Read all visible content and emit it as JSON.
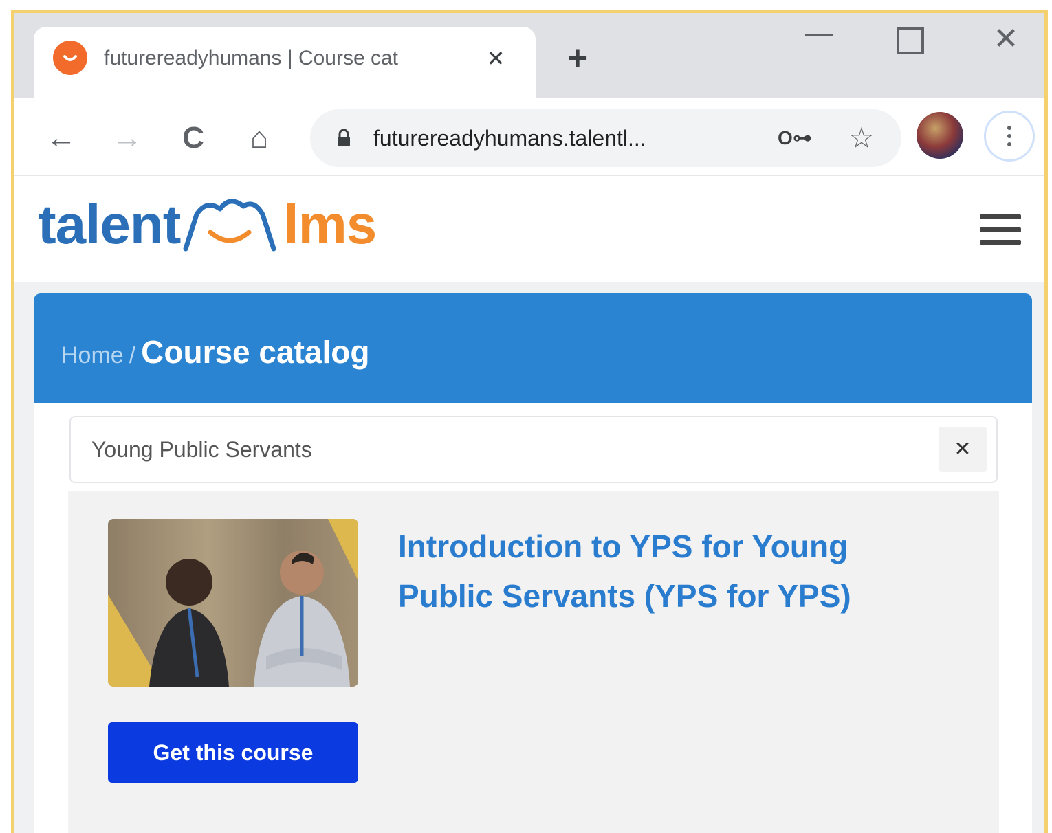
{
  "browser": {
    "tab": {
      "title": "futurereadyhumans | Course cat",
      "close_glyph": "✕"
    },
    "new_tab_glyph": "+",
    "window_controls": {
      "minimize": "",
      "maximize": "",
      "close": "✕"
    },
    "toolbar": {
      "back_glyph": "←",
      "forward_glyph": "→",
      "reload_glyph": "C",
      "home_glyph": "⌂",
      "url": "futurereadyhumans.talentl...",
      "key_glyph": "O⊶",
      "star_glyph": "☆"
    }
  },
  "site": {
    "logo": {
      "part1": "talent",
      "part2": "lms"
    },
    "breadcrumb": {
      "home": "Home",
      "separator": "/",
      "current": "Course catalog"
    },
    "search": {
      "value": "Young Public Servants",
      "clear_glyph": "✕"
    },
    "courses": [
      {
        "title": "Introduction to YPS for Young Public Servants (YPS for YPS)",
        "button": "Get this course"
      }
    ]
  },
  "colors": {
    "accent_blue": "#2a84d2",
    "button_blue": "#0b3be0",
    "logo_orange": "#f28c2c",
    "logo_blue": "#2a6fb7",
    "frame_yellow": "#f4d06f"
  },
  "icons": [
    "favicon-icon",
    "close-icon",
    "plus-icon",
    "back-arrow-icon",
    "forward-arrow-icon",
    "reload-icon",
    "home-icon",
    "lock-icon",
    "key-icon",
    "star-icon",
    "avatar",
    "more-vert-icon",
    "hamburger-icon"
  ]
}
